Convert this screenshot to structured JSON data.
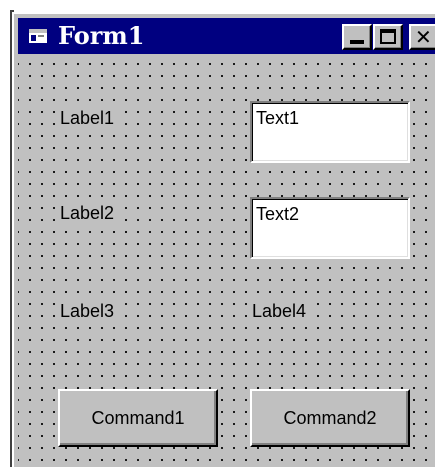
{
  "window": {
    "title": "Form1",
    "icon": "form-icon",
    "controls": {
      "minimize_icon": "minimize-icon",
      "maximize_icon": "maximize-icon",
      "close_icon": "close-icon",
      "close_glyph": "✕"
    }
  },
  "form": {
    "grid": "dotted design grid",
    "labels": [
      "Label1",
      "Label2",
      "Label3",
      "Label4"
    ],
    "textboxes": [
      "Text1",
      "Text2"
    ],
    "buttons": [
      "Command1",
      "Command2"
    ]
  },
  "colors": {
    "titlebar": "#000080",
    "face": "#c0c0c0",
    "textbox_bg": "#ffffff"
  }
}
